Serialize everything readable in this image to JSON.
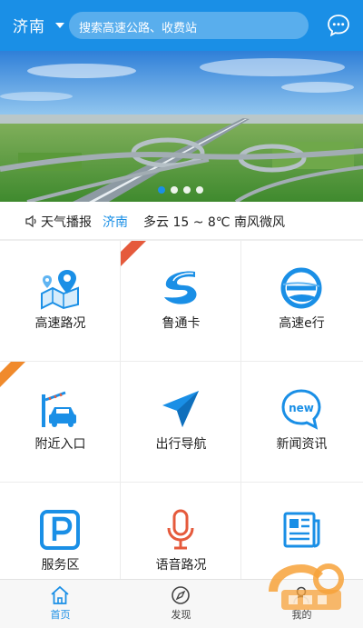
{
  "header": {
    "city": "济南",
    "search_placeholder": "搜索高速公路、收费站"
  },
  "banner": {
    "slides": 4,
    "active_slide": 1
  },
  "weather": {
    "label": "天气播报",
    "city": "济南",
    "description": "多云  15 ~ 8℃  南风微风"
  },
  "services": [
    {
      "label": "高速路况",
      "icon": "map-pin-icon"
    },
    {
      "label": "鲁通卡",
      "icon": "lutong-card-icon"
    },
    {
      "label": "高速e行",
      "icon": "e-travel-icon"
    },
    {
      "label": "附近入口",
      "icon": "car-entrance-icon"
    },
    {
      "label": "出行导航",
      "icon": "navigation-arrow-icon"
    },
    {
      "label": "新闻资讯",
      "icon": "news-bubble-icon"
    },
    {
      "label": "服务区",
      "icon": "parking-icon"
    },
    {
      "label": "语音路况",
      "icon": "microphone-icon"
    },
    {
      "label": "",
      "icon": "newspaper-icon"
    }
  ],
  "bottom_nav": [
    {
      "label": "首页",
      "icon": "home-icon",
      "active": true
    },
    {
      "label": "发现",
      "icon": "compass-icon",
      "active": false
    },
    {
      "label": "我的",
      "icon": "user-icon",
      "active": false
    }
  ],
  "colors": {
    "primary": "#1a8fe6",
    "ribbon": "#f08a2c"
  }
}
